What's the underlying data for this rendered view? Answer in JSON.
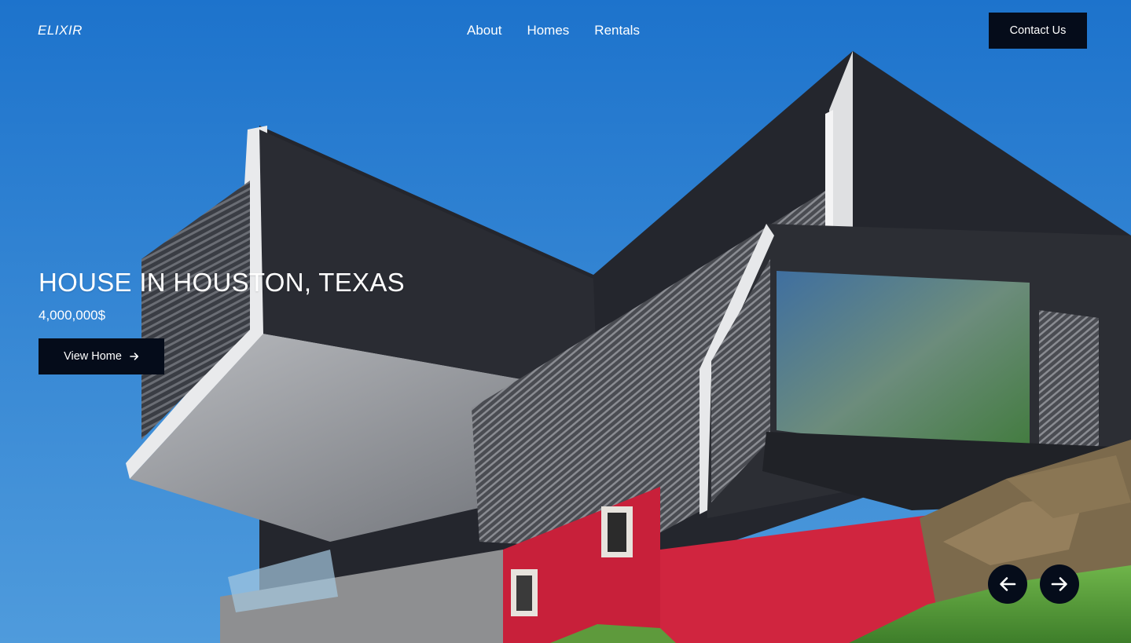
{
  "header": {
    "logo": "ELIXIR",
    "nav": [
      {
        "label": "About"
      },
      {
        "label": "Homes"
      },
      {
        "label": "Rentals"
      }
    ],
    "contact_label": "Contact Us"
  },
  "hero": {
    "title": "HOUSE IN HOUSTON, TEXAS",
    "price": "4,000,000$",
    "cta_label": "View Home",
    "cta_icon": "arrow-right-icon",
    "prev_icon": "arrow-left-icon",
    "next_icon": "arrow-right-icon"
  },
  "colors": {
    "sky": "#2f7fd0",
    "button_dark": "#050c1a",
    "text": "#ffffff"
  }
}
